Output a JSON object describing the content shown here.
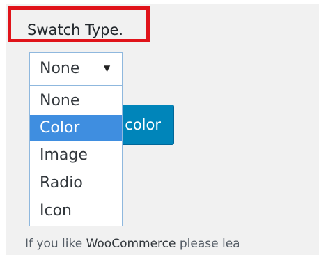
{
  "swatch": {
    "label": "Swatch Type."
  },
  "select": {
    "value": "None",
    "options": [
      "None",
      "Color",
      "Image",
      "Radio",
      "Icon"
    ],
    "highlighted": "Color"
  },
  "button": {
    "label": "color"
  },
  "footer": {
    "prefix": "If you like ",
    "brand": "WooCommerce",
    "suffix": " please lea"
  },
  "colors": {
    "highlight_border": "#e0131a",
    "button_bg": "#0085ba",
    "option_selected_bg": "#3f8ee0",
    "panel_bg": "#f1f1f1"
  }
}
